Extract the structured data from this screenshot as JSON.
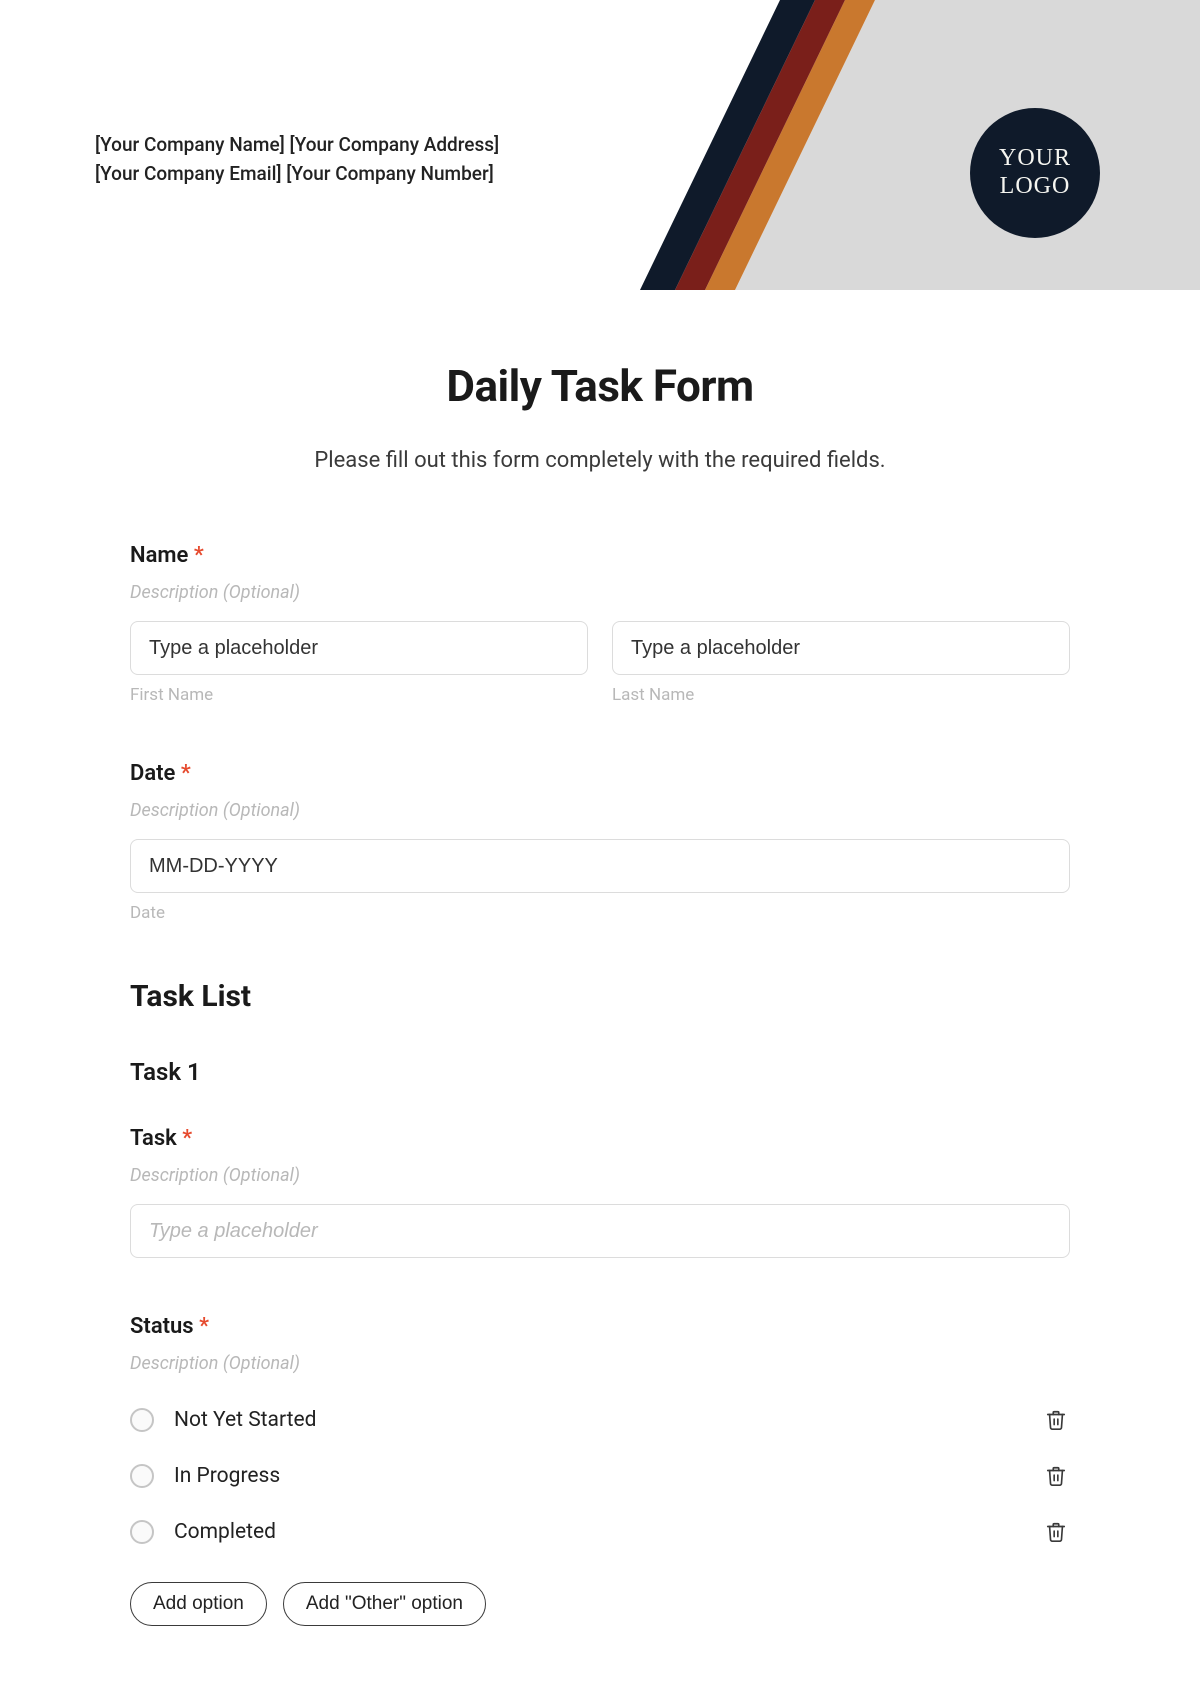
{
  "header": {
    "company_line1": "[Your Company Name] [Your Company Address]",
    "company_line2": "[Your Company Email] [Your Company Number]",
    "logo_line1": "YOUR",
    "logo_line2": "LOGO"
  },
  "form": {
    "title": "Daily Task Form",
    "subtitle": "Please fill out this form completely with the required fields.",
    "required_mark": "*",
    "name": {
      "label": "Name",
      "description": "Description (Optional)",
      "first_placeholder": "Type a placeholder",
      "first_hint": "First Name",
      "last_placeholder": "Type a placeholder",
      "last_hint": "Last Name"
    },
    "date": {
      "label": "Date",
      "description": "Description (Optional)",
      "placeholder": "MM-DD-YYYY",
      "hint": "Date"
    },
    "task_list_heading": "Task List",
    "task1_heading": "Task 1",
    "task": {
      "label": "Task",
      "description": "Description (Optional)",
      "placeholder": "Type a placeholder"
    },
    "status": {
      "label": "Status",
      "description": "Description (Optional)",
      "options": [
        "Not Yet Started",
        "In Progress",
        "Completed"
      ],
      "add_option": "Add option",
      "add_other": "Add \"Other\" option"
    }
  },
  "colors": {
    "stripe_navy": "#0f1a2a",
    "stripe_red": "#7a1f1a",
    "stripe_orange": "#c9782e",
    "panel_gray": "#d9d9d9"
  }
}
